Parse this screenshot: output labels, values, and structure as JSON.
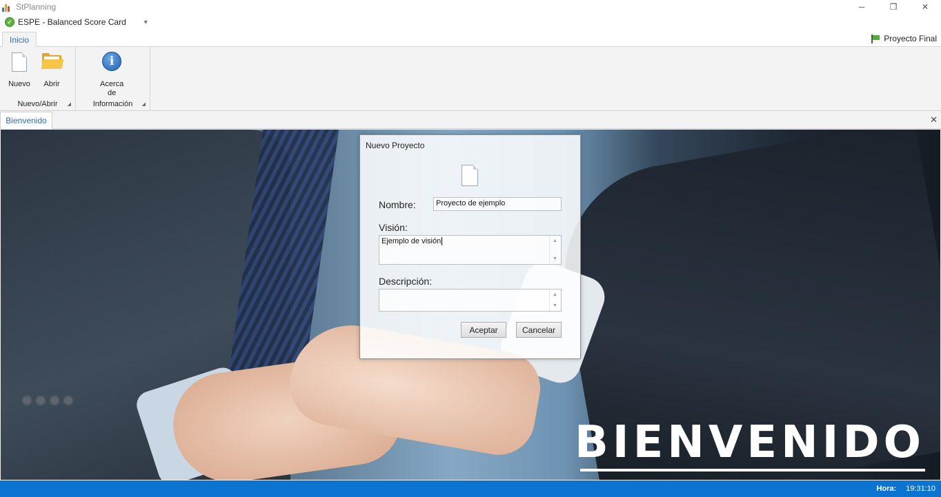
{
  "window": {
    "title": "StPlanning",
    "controls": {
      "minimize": "─",
      "restore": "❐",
      "close": "✕"
    }
  },
  "quick_access": {
    "title": "ESPE - Balanced Score Card",
    "dropdown_glyph": "▼"
  },
  "ribbon": {
    "tabs": [
      {
        "label": "Inicio",
        "active": true
      }
    ],
    "project_label": "Proyecto Final",
    "groups": [
      {
        "label": "Nuevo/Abrir",
        "buttons": [
          {
            "label": "Nuevo",
            "icon": "new-document-icon"
          },
          {
            "label": "Abrir",
            "icon": "open-folder-icon"
          }
        ]
      },
      {
        "label": "Información",
        "buttons": [
          {
            "label_line1": "Acerca",
            "label_line2": "de",
            "icon": "info-icon"
          }
        ]
      }
    ],
    "launcher_glyph": "◢"
  },
  "document_tabs": {
    "tabs": [
      {
        "label": "Bienvenido"
      }
    ],
    "close_glyph": "✕"
  },
  "welcome_text": "BIENVENIDO",
  "dialog": {
    "title": "Nuevo Proyecto",
    "name_label": "Nombre:",
    "name_value": "Proyecto de ejemplo",
    "vision_label": "Visión:",
    "vision_value": "Ejemplo de visión",
    "description_label": "Descripción:",
    "description_value": "",
    "accept_label": "Aceptar",
    "cancel_label": "Cancelar",
    "scroll_up_glyph": "▲",
    "scroll_down_glyph": "▼"
  },
  "status_bar": {
    "time_label": "Hora:",
    "time_value": "19:31:10"
  },
  "colors": {
    "accent": "#2b6cb8",
    "status_bar": "#0a74d0"
  }
}
